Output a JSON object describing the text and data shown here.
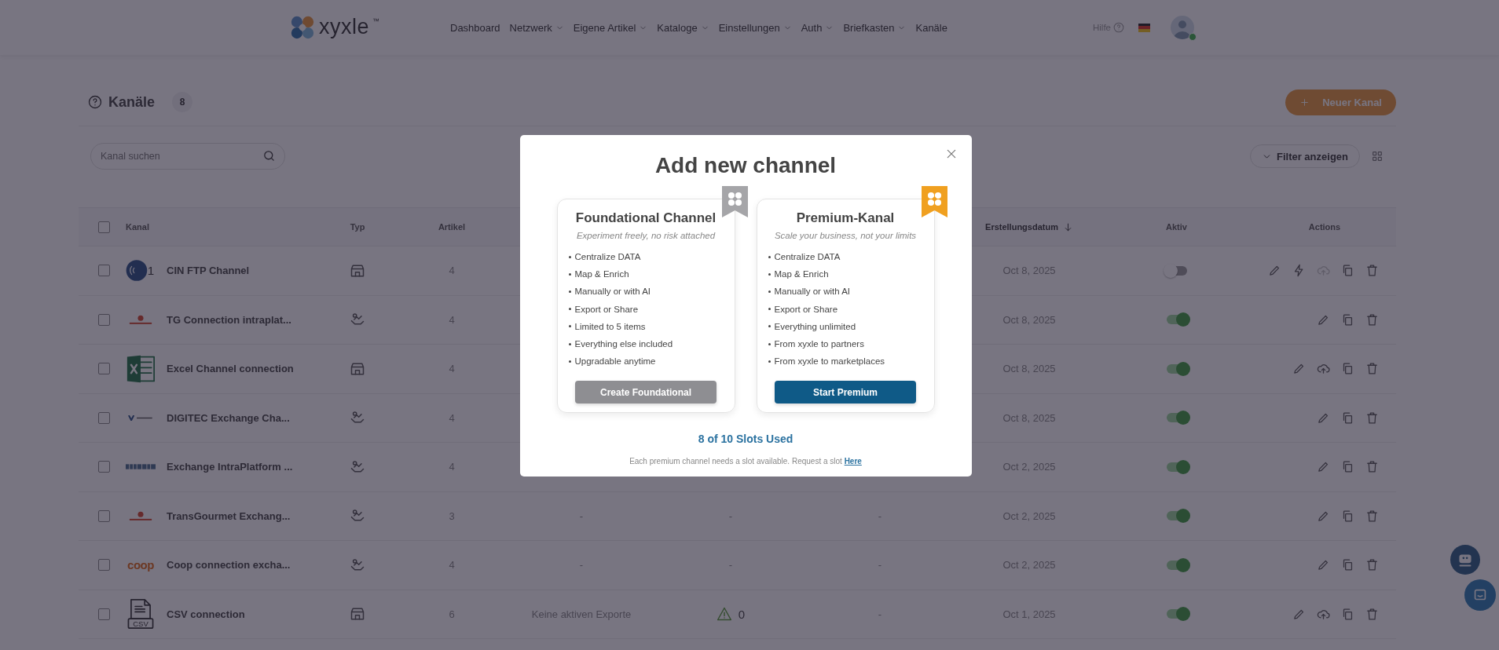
{
  "topbar": {
    "logo": "xyxle",
    "logo_mark": "™",
    "nav": [
      {
        "label": "Dashboard",
        "dropdown": false
      },
      {
        "label": "Netzwerk",
        "dropdown": true
      },
      {
        "label": "Eigene Artikel",
        "dropdown": true
      },
      {
        "label": "Kataloge",
        "dropdown": true
      },
      {
        "label": "Einstellungen",
        "dropdown": true
      },
      {
        "label": "Auth",
        "dropdown": true
      },
      {
        "label": "Briefkasten",
        "dropdown": true
      },
      {
        "label": "Kanäle",
        "dropdown": false
      }
    ],
    "help": "Hilfe",
    "online": true
  },
  "page": {
    "title": "Kanäle",
    "count": "8",
    "new_button": "Neuer Kanal",
    "search": {
      "placeholder": "Kanal suchen"
    },
    "filter_button": "Filter anzeigen"
  },
  "table": {
    "all_checked": false,
    "columns": [
      {
        "label": "Kanal",
        "sorted": false
      },
      {
        "label": "Typ",
        "sorted": false
      },
      {
        "label": "Artikel",
        "sorted": false
      },
      {
        "label": "Erstellungsdatum",
        "sorted": true
      },
      {
        "label": "Aktiv",
        "sorted": false
      },
      {
        "label": "Actions",
        "sorted": false
      }
    ],
    "rows": [
      {
        "checked": false,
        "name": "CIN FTP Channel",
        "logo": {
          "kind": "gs1",
          "text": "1"
        },
        "type": {
          "kind": "store"
        },
        "artikel": "4",
        "date": "Oct 8, 2025",
        "active": false,
        "actions": [
          {
            "kind": "edit",
            "disabled": false
          },
          {
            "kind": "bolt",
            "disabled": false
          },
          {
            "kind": "upload",
            "disabled": true
          },
          {
            "kind": "copy",
            "disabled": false
          },
          {
            "kind": "delete",
            "disabled": false
          }
        ]
      },
      {
        "checked": false,
        "name": "TG Connection intraplat...",
        "logo": {
          "kind": "transgourmet"
        },
        "type": {
          "kind": "exchange"
        },
        "artikel": "4",
        "date": "Oct 8, 2025",
        "active": true,
        "actions": [
          {
            "kind": "edit",
            "disabled": false
          },
          {
            "kind": "copy",
            "disabled": false
          },
          {
            "kind": "delete",
            "disabled": false
          }
        ]
      },
      {
        "checked": false,
        "name": "Excel Channel connection",
        "logo": {
          "kind": "excel"
        },
        "type": {
          "kind": "store"
        },
        "artikel": "4",
        "date": "Oct 8, 2025",
        "active": true,
        "actions": [
          {
            "kind": "edit",
            "disabled": false
          },
          {
            "kind": "upload",
            "disabled": false
          },
          {
            "kind": "copy",
            "disabled": false
          },
          {
            "kind": "delete",
            "disabled": false
          }
        ]
      },
      {
        "checked": false,
        "name": "DIGITEC Exchange Cha...",
        "logo": {
          "kind": "digitec"
        },
        "type": {
          "kind": "exchange"
        },
        "artikel": "4",
        "date": "Oct 8, 2025",
        "active": true,
        "actions": [
          {
            "kind": "edit",
            "disabled": false
          },
          {
            "kind": "copy",
            "disabled": false
          },
          {
            "kind": "delete",
            "disabled": false
          }
        ]
      },
      {
        "checked": false,
        "name": "Exchange IntraPlatform ...",
        "logo": {
          "kind": "intraplatform"
        },
        "type": {
          "kind": "exchange"
        },
        "artikel": "4",
        "date": "Oct 2, 2025",
        "active": true,
        "actions": [
          {
            "kind": "edit",
            "disabled": false
          },
          {
            "kind": "copy",
            "disabled": false
          },
          {
            "kind": "delete",
            "disabled": false
          }
        ]
      },
      {
        "checked": false,
        "name": "TransGourmet Exchang...",
        "logo": {
          "kind": "transgourmet"
        },
        "type": {
          "kind": "exchange"
        },
        "artikel": "3",
        "column_4": "-",
        "column_5": {
          "kind": "plain",
          "text": "-"
        },
        "column_6": "-",
        "date": "Oct 2, 2025",
        "active": true,
        "actions": [
          {
            "kind": "edit",
            "disabled": false
          },
          {
            "kind": "copy",
            "disabled": false
          },
          {
            "kind": "delete",
            "disabled": false
          }
        ]
      },
      {
        "checked": false,
        "name": "Coop connection excha...",
        "logo": {
          "kind": "coop",
          "text": "coop"
        },
        "type": {
          "kind": "exchange"
        },
        "artikel": "4",
        "column_4": "-",
        "column_5": {
          "kind": "plain",
          "text": "-"
        },
        "column_6": "-",
        "date": "Oct 2, 2025",
        "active": true,
        "actions": [
          {
            "kind": "edit",
            "disabled": false
          },
          {
            "kind": "copy",
            "disabled": false
          },
          {
            "kind": "delete",
            "disabled": false
          }
        ]
      },
      {
        "checked": false,
        "name": "CSV connection",
        "logo": {
          "kind": "csv",
          "text": "CSV"
        },
        "type": {
          "kind": "store"
        },
        "artikel": "6",
        "column_4": "Keine aktiven Exporte",
        "column_5": {
          "kind": "warning",
          "text": "0"
        },
        "column_6": "-",
        "date": "Oct 1, 2025",
        "active": true,
        "actions": [
          {
            "kind": "edit",
            "disabled": false
          },
          {
            "kind": "upload",
            "disabled": false
          },
          {
            "kind": "copy",
            "disabled": false
          },
          {
            "kind": "delete",
            "disabled": false
          }
        ]
      }
    ]
  },
  "modal": {
    "title": "Add new channel",
    "plans": [
      {
        "kind": "basic",
        "name": "Foundational Channel",
        "tagline": "Experiment freely, no risk attached",
        "features": [
          "Centralize DATA",
          "Map & Enrich",
          "Manually or with AI",
          "Export or Share",
          "Limited to 5 items",
          "Everything else included",
          "Upgradable anytime"
        ],
        "button": "Create Foundational",
        "primary": false
      },
      {
        "kind": "premium",
        "name": "Premium-Kanal",
        "tagline": "Scale your business, not your limits",
        "features": [
          "Centralize DATA",
          "Map & Enrich",
          "Manually or with AI",
          "Export or Share",
          "Everything unlimited",
          "From xyxle to partners",
          "From xyxle to marketplaces"
        ],
        "button": "Start Premium",
        "primary": true
      }
    ],
    "slots": "8 of 10 Slots Used",
    "note": "Each premium channel needs a slot available. Request a slot",
    "note_link": "Here"
  }
}
